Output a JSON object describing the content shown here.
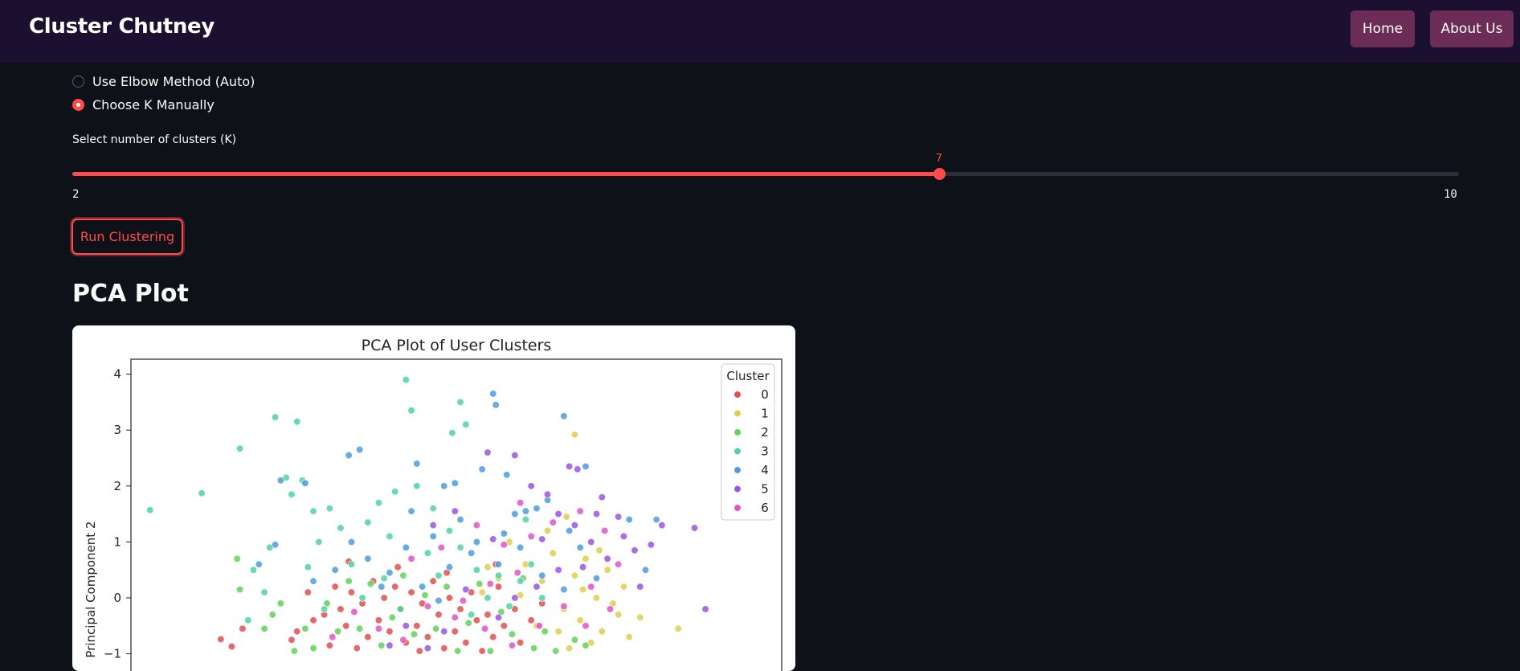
{
  "app": {
    "title": "Cluster Chutney"
  },
  "nav": {
    "home": "Home",
    "about": "About Us"
  },
  "method": {
    "options": [
      "Use Elbow Method (Auto)",
      "Choose K Manually"
    ],
    "selected": "Choose K Manually"
  },
  "slider": {
    "label": "Select number of clusters (K)",
    "min": "2",
    "max": "10",
    "value": "7"
  },
  "run_button": "Run Clustering",
  "section": {
    "title": "PCA Plot"
  },
  "chart_data": {
    "type": "scatter",
    "title": "PCA Plot of User Clusters",
    "xlabel": "",
    "ylabel": "Principal Component 2",
    "ylim": [
      -1.1,
      4.25
    ],
    "yticks": [
      "4",
      "3",
      "2",
      "1",
      "0",
      "−1"
    ],
    "grid": false,
    "legend": {
      "title": "Cluster",
      "placement": "top-right",
      "entries": [
        "0",
        "1",
        "2",
        "3",
        "4",
        "5",
        "6"
      ]
    },
    "colors": [
      "#e24f4f",
      "#e0cd4e",
      "#62d15c",
      "#4ed3a0",
      "#4c9cdd",
      "#9a55e2",
      "#e154c6"
    ],
    "series": [
      {
        "name": "0",
        "points": [
          [
            -2.9,
            -0.74
          ],
          [
            -2.7,
            -0.87
          ],
          [
            -2.5,
            -0.55
          ],
          [
            -1.6,
            -0.75
          ],
          [
            -1.5,
            -0.6
          ],
          [
            -1.3,
            0.1
          ],
          [
            -1.2,
            -0.4
          ],
          [
            -1.0,
            -0.3
          ],
          [
            -0.9,
            -0.85
          ],
          [
            -0.8,
            0.2
          ],
          [
            -0.7,
            -0.2
          ],
          [
            -0.6,
            -0.5
          ],
          [
            -0.5,
            0.1
          ],
          [
            -0.4,
            -0.9
          ],
          [
            -0.3,
            -0.1
          ],
          [
            -0.2,
            -0.7
          ],
          [
            -0.1,
            0.3
          ],
          [
            0.0,
            -0.4
          ],
          [
            0.1,
            0.0
          ],
          [
            0.2,
            -0.6
          ],
          [
            0.3,
            0.2
          ],
          [
            0.4,
            -0.2
          ],
          [
            0.5,
            -0.8
          ],
          [
            0.6,
            0.1
          ],
          [
            0.7,
            -0.5
          ],
          [
            0.8,
            -0.1
          ],
          [
            0.9,
            -0.7
          ],
          [
            1.0,
            0.3
          ],
          [
            1.1,
            -0.3
          ],
          [
            1.2,
            -0.9
          ],
          [
            1.3,
            0.0
          ],
          [
            1.4,
            -0.6
          ],
          [
            1.5,
            -0.2
          ],
          [
            1.6,
            -0.8
          ],
          [
            1.7,
            0.1
          ],
          [
            1.8,
            -0.4
          ],
          [
            1.9,
            -0.95
          ],
          [
            2.0,
            -0.3
          ],
          [
            2.1,
            -0.7
          ],
          [
            2.2,
            0.2
          ],
          [
            2.3,
            -0.5
          ],
          [
            2.5,
            -0.2
          ],
          [
            2.6,
            -0.8
          ],
          [
            2.8,
            -0.4
          ],
          [
            3.0,
            -0.1
          ],
          [
            -0.55,
            0.65
          ],
          [
            0.35,
            0.55
          ],
          [
            1.25,
            0.45
          ],
          [
            2.15,
            0.6
          ],
          [
            0.75,
            -0.95
          ]
        ]
      },
      {
        "name": "1",
        "points": [
          [
            3.6,
            2.92
          ],
          [
            2.4,
            1.0
          ],
          [
            2.7,
            0.6
          ],
          [
            3.0,
            0.3
          ],
          [
            3.2,
            0.8
          ],
          [
            3.4,
            -0.2
          ],
          [
            3.6,
            0.4
          ],
          [
            3.8,
            0.7
          ],
          [
            4.0,
            0.0
          ],
          [
            4.2,
            0.5
          ],
          [
            4.4,
            -0.3
          ],
          [
            4.6,
            -0.7
          ],
          [
            2.9,
            -0.5
          ],
          [
            3.3,
            -0.6
          ],
          [
            3.5,
            -0.9
          ],
          [
            3.7,
            -0.4
          ],
          [
            3.9,
            -0.8
          ],
          [
            4.1,
            -0.6
          ],
          [
            4.3,
            -0.1
          ],
          [
            4.5,
            0.2
          ],
          [
            4.8,
            -0.35
          ],
          [
            5.5,
            -0.55
          ],
          [
            2.2,
            0.35
          ],
          [
            2.6,
            0.05
          ],
          [
            3.1,
            1.2
          ],
          [
            3.45,
            1.45
          ],
          [
            3.75,
            0.15
          ],
          [
            4.05,
            0.85
          ],
          [
            1.9,
            0.1
          ],
          [
            2.0,
            0.55
          ]
        ]
      },
      {
        "name": "2",
        "points": [
          [
            -2.55,
            0.15
          ],
          [
            -2.6,
            0.7
          ],
          [
            -2.1,
            -0.55
          ],
          [
            -1.95,
            -0.3
          ],
          [
            -1.8,
            -0.1
          ],
          [
            -1.55,
            -0.95
          ],
          [
            -1.35,
            -0.55
          ],
          [
            -1.2,
            -0.9
          ],
          [
            -0.95,
            -0.1
          ],
          [
            -0.75,
            -0.6
          ],
          [
            -0.55,
            0.3
          ],
          [
            -0.35,
            -0.55
          ],
          [
            -0.15,
            0.25
          ],
          [
            0.05,
            -0.85
          ],
          [
            0.25,
            -0.35
          ],
          [
            0.45,
            0.4
          ],
          [
            0.65,
            -0.65
          ],
          [
            0.85,
            0.05
          ],
          [
            1.05,
            -0.55
          ],
          [
            1.25,
            0.2
          ],
          [
            1.45,
            -0.95
          ],
          [
            1.65,
            -0.45
          ],
          [
            1.85,
            0.25
          ],
          [
            2.05,
            -0.95
          ],
          [
            2.25,
            -0.25
          ],
          [
            2.45,
            -0.65
          ],
          [
            2.65,
            0.35
          ],
          [
            2.85,
            -0.9
          ],
          [
            3.05,
            -0.6
          ],
          [
            3.25,
            -0.95
          ],
          [
            3.6,
            -0.75
          ],
          [
            3.8,
            -0.85
          ]
        ]
      },
      {
        "name": "3",
        "points": [
          [
            -4.2,
            1.57
          ],
          [
            -3.25,
            1.87
          ],
          [
            -2.55,
            2.67
          ],
          [
            -1.9,
            3.23
          ],
          [
            -1.5,
            3.15
          ],
          [
            -1.7,
            2.15
          ],
          [
            -1.4,
            2.1
          ],
          [
            -0.9,
            1.6
          ],
          [
            -1.6,
            1.85
          ],
          [
            -1.2,
            1.55
          ],
          [
            -0.7,
            1.25
          ],
          [
            -1.1,
            1.0
          ],
          [
            -1.3,
            0.55
          ],
          [
            -0.5,
            0.6
          ],
          [
            0.5,
            3.9
          ],
          [
            0.6,
            3.35
          ],
          [
            1.5,
            3.5
          ],
          [
            1.35,
            2.95
          ],
          [
            1.6,
            3.1
          ],
          [
            0.3,
            1.9
          ],
          [
            0.7,
            2.0
          ],
          [
            1.0,
            1.6
          ],
          [
            1.3,
            1.2
          ],
          [
            0.9,
            0.8
          ],
          [
            1.1,
            0.4
          ],
          [
            1.5,
            0.9
          ],
          [
            1.8,
            0.5
          ],
          [
            2.0,
            0.0
          ],
          [
            2.2,
            0.4
          ],
          [
            2.6,
            0.3
          ],
          [
            2.8,
            0.6
          ],
          [
            3.0,
            0.0
          ],
          [
            -2.0,
            0.9
          ],
          [
            -2.3,
            0.5
          ],
          [
            -2.1,
            0.1
          ],
          [
            -0.3,
            0.0
          ],
          [
            0.1,
            0.35
          ],
          [
            0.4,
            -0.2
          ],
          [
            1.7,
            -0.3
          ],
          [
            2.4,
            -0.15
          ],
          [
            -0.2,
            1.35
          ],
          [
            0.2,
            1.1
          ],
          [
            -2.4,
            -0.4
          ],
          [
            -1.0,
            -0.2
          ],
          [
            2.7,
            1.4
          ],
          [
            0.0,
            1.7
          ]
        ]
      },
      {
        "name": "4",
        "points": [
          [
            -1.8,
            2.1
          ],
          [
            -1.35,
            2.05
          ],
          [
            -0.55,
            2.55
          ],
          [
            -0.35,
            2.65
          ],
          [
            0.7,
            2.4
          ],
          [
            1.2,
            2.0
          ],
          [
            1.4,
            2.05
          ],
          [
            1.9,
            2.3
          ],
          [
            2.1,
            3.65
          ],
          [
            2.15,
            3.45
          ],
          [
            2.35,
            2.2
          ],
          [
            2.9,
            1.6
          ],
          [
            3.4,
            3.25
          ],
          [
            3.8,
            2.35
          ],
          [
            2.5,
            1.5
          ],
          [
            0.6,
            1.55
          ],
          [
            1.0,
            1.1
          ],
          [
            1.5,
            1.4
          ],
          [
            1.8,
            1.0
          ],
          [
            2.3,
            1.15
          ],
          [
            2.7,
            1.55
          ],
          [
            3.1,
            1.75
          ],
          [
            3.5,
            1.2
          ],
          [
            -2.2,
            0.6
          ],
          [
            -1.9,
            0.95
          ],
          [
            -1.2,
            0.3
          ],
          [
            -0.8,
            0.5
          ],
          [
            -0.5,
            1.0
          ],
          [
            -0.2,
            0.7
          ],
          [
            0.2,
            0.45
          ],
          [
            0.5,
            0.9
          ],
          [
            0.8,
            0.2
          ],
          [
            1.3,
            0.55
          ],
          [
            1.7,
            0.8
          ],
          [
            2.2,
            0.6
          ],
          [
            2.6,
            0.9
          ],
          [
            3.0,
            0.4
          ],
          [
            3.4,
            0.15
          ],
          [
            3.7,
            0.9
          ],
          [
            4.0,
            0.35
          ],
          [
            4.6,
            1.4
          ],
          [
            4.9,
            0.5
          ],
          [
            5.1,
            1.4
          ],
          [
            0.05,
            0.2
          ],
          [
            1.1,
            -0.05
          ]
        ]
      },
      {
        "name": "5",
        "points": [
          [
            2.0,
            2.6
          ],
          [
            2.5,
            2.55
          ],
          [
            4.1,
            1.8
          ],
          [
            4.0,
            1.5
          ],
          [
            3.5,
            2.35
          ],
          [
            3.65,
            2.3
          ],
          [
            2.8,
            2.0
          ],
          [
            3.1,
            1.85
          ],
          [
            3.3,
            1.5
          ],
          [
            3.6,
            1.3
          ],
          [
            4.4,
            1.45
          ],
          [
            4.5,
            1.1
          ],
          [
            5.0,
            0.95
          ],
          [
            5.2,
            1.3
          ],
          [
            5.8,
            1.25
          ],
          [
            6.0,
            -0.2
          ],
          [
            4.8,
            0.2
          ],
          [
            4.2,
            0.7
          ],
          [
            3.9,
            1.0
          ],
          [
            3.3,
            0.5
          ],
          [
            2.9,
            0.2
          ],
          [
            2.5,
            0.0
          ],
          [
            2.2,
            -0.35
          ],
          [
            1.6,
            0.15
          ],
          [
            1.2,
            -0.6
          ],
          [
            0.9,
            -0.9
          ],
          [
            0.5,
            -0.5
          ],
          [
            0.2,
            -0.85
          ],
          [
            2.1,
            1.05
          ],
          [
            1.4,
            1.55
          ],
          [
            1.0,
            1.3
          ],
          [
            4.7,
            0.85
          ],
          [
            3.0,
            1.05
          ],
          [
            3.75,
            0.55
          ]
        ]
      },
      {
        "name": "6",
        "points": [
          [
            1.55,
            -0.05
          ],
          [
            2.3,
            0.95
          ],
          [
            2.8,
            1.1
          ],
          [
            3.2,
            1.35
          ],
          [
            3.7,
            1.55
          ],
          [
            4.15,
            1.2
          ],
          [
            4.4,
            0.6
          ],
          [
            3.9,
            0.2
          ],
          [
            3.4,
            -0.15
          ],
          [
            2.95,
            -0.5
          ],
          [
            2.45,
            -0.85
          ],
          [
            1.95,
            -0.55
          ],
          [
            1.4,
            -0.35
          ],
          [
            0.9,
            -0.15
          ],
          [
            0.45,
            -0.75
          ],
          [
            0.0,
            -0.55
          ],
          [
            -0.45,
            -0.25
          ],
          [
            -0.85,
            -0.7
          ],
          [
            1.8,
            1.3
          ],
          [
            2.6,
            1.7
          ],
          [
            3.8,
            -0.5
          ],
          [
            4.25,
            -0.2
          ],
          [
            0.6,
            0.7
          ],
          [
            1.15,
            0.9
          ],
          [
            2.05,
            0.25
          ],
          [
            2.55,
            0.45
          ]
        ]
      }
    ]
  }
}
